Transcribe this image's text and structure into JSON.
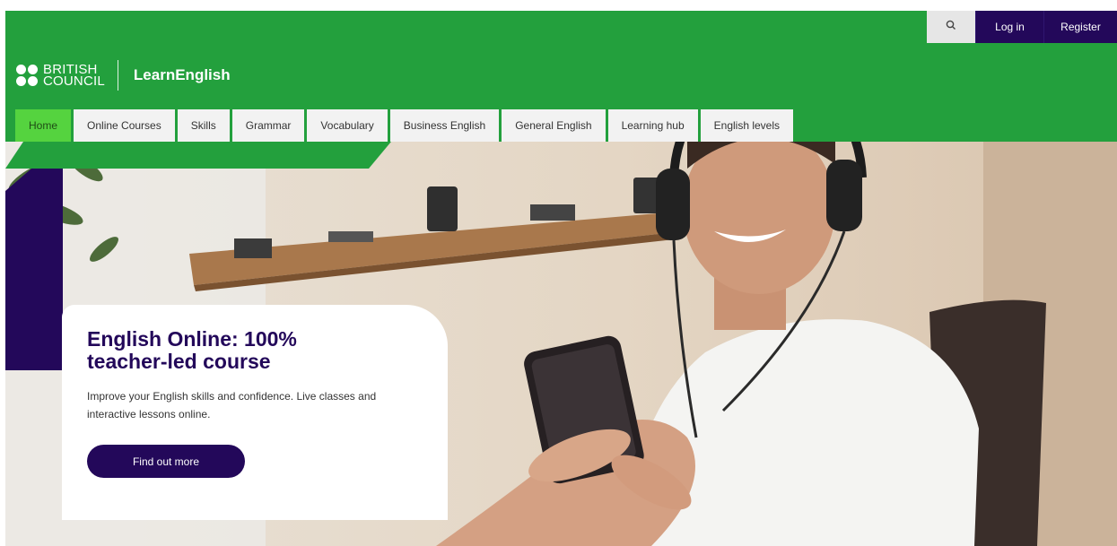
{
  "utility_bar": {
    "search_icon": "search-icon",
    "login_label": "Log in",
    "register_label": "Register"
  },
  "brand": {
    "org_line1": "BRITISH",
    "org_line2": "COUNCIL",
    "site_name": "LearnEnglish"
  },
  "nav": {
    "items": [
      {
        "label": "Home",
        "active": true
      },
      {
        "label": "Online Courses"
      },
      {
        "label": "Skills"
      },
      {
        "label": "Grammar"
      },
      {
        "label": "Vocabulary"
      },
      {
        "label": "Business English"
      },
      {
        "label": "General English"
      },
      {
        "label": "Learning hub"
      },
      {
        "label": "English levels"
      }
    ]
  },
  "hero": {
    "title": "English Online: 100% teacher-led course",
    "description": "Improve your English skills and confidence. Live classes and interactive lessons online.",
    "cta_label": "Find out more"
  },
  "colors": {
    "brand_green": "#23a03d",
    "active_nav_green": "#55d33f",
    "brand_purple": "#23085a"
  }
}
